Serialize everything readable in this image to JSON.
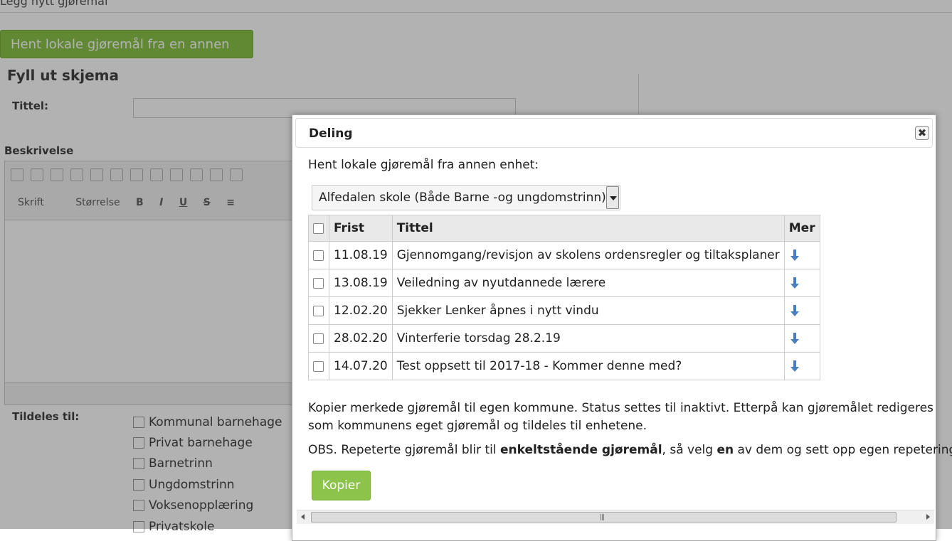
{
  "background": {
    "page_title": "Legg nytt gjøremål",
    "fetch_button": "Hent lokale gjøremål fra en annen enhet",
    "form_heading": "Fyll ut skjema",
    "title_label": "Tittel:",
    "description_label": "Beskrivelse",
    "font_dropdown": "Skrift",
    "size_dropdown": "Størrelse",
    "assigned_label": "Tildeles til:",
    "assign_options": [
      "Kommunal barnehage",
      "Privat barnehage",
      "Barnetrinn",
      "Ungdomstrinn",
      "Voksenopplæring",
      "Privatskole"
    ]
  },
  "dialog": {
    "title": "Deling",
    "close_label": "✖",
    "prompt": "Hent lokale gjøremål fra annen enhet:",
    "unit_select": "Alfedalen skole (Både Barne -og ungdomstrinn)",
    "columns": {
      "frist": "Frist",
      "tittel": "Tittel",
      "mer": "Mer"
    },
    "rows": [
      {
        "frist": "11.08.19",
        "tittel": "Gjennomgang/revisjon av skolens ordensregler og tiltaksplaner"
      },
      {
        "frist": "13.08.19",
        "tittel": "Veiledning av nyutdannede lærere"
      },
      {
        "frist": "12.02.20",
        "tittel": "Sjekker Lenker åpnes i nytt vindu"
      },
      {
        "frist": "28.02.20",
        "tittel": "Vinterferie torsdag 28.2.19"
      },
      {
        "frist": "14.07.20",
        "tittel": "Test oppsett til 2017-18 - Kommer denne med?"
      }
    ],
    "info_text": "Kopier merkede gjøremål til egen kommune. Status settes til inaktivt. Etterpå kan gjøremålet redigeres som kommunens eget gjøremål og tildeles til enhetene.",
    "obs_prefix": "OBS. Repeterte gjøremål blir til ",
    "obs_bold1": "enkeltstående gjøremål",
    "obs_mid": ", så velg ",
    "obs_bold2": "en",
    "obs_suffix": " av dem og sett opp egen repetering.",
    "copy_button": "Kopier",
    "accent_color": "#8cc34a",
    "icon_color": "#4a7fbf"
  }
}
